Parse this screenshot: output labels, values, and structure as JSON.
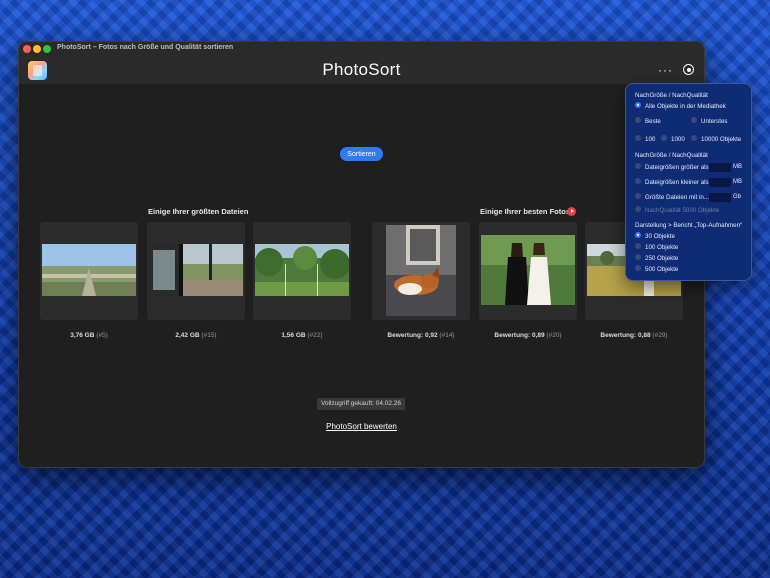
{
  "window": {
    "title": "PhotoSort – Fotos nach Größe und Qualität sortieren",
    "app_name": "PhotoSort"
  },
  "toolbar": {
    "more_icon": "more-icon",
    "settings_icon": "settings-icon",
    "more_glyph": "···"
  },
  "main": {
    "sort_button": "Sortieren",
    "largest_title": "Einige Ihrer größten Dateien",
    "best_title": "Einige Ihrer besten Fotos",
    "largest": [
      {
        "size": "3,76 GB",
        "rank": "(#5)"
      },
      {
        "size": "2,42 GB",
        "rank": "(#15)"
      },
      {
        "size": "1,56 GB",
        "rank": "(#22)"
      }
    ],
    "best": [
      {
        "score": "Bewertung: 0,92",
        "rank": "(#14)"
      },
      {
        "score": "Bewertung: 0,89",
        "rank": "(#20)"
      },
      {
        "score": "Bewertung: 0,88",
        "rank": "(#29)"
      }
    ],
    "purchase_text": "Vollzugriff gekauft: 04.02.26",
    "rate_link": "PhotoSort bewerten"
  },
  "panel": {
    "heading1": "NachGröße / NachQualität",
    "all_objects": "Alle Objekte in der Mediathek",
    "best": "Beste",
    "lowest": "Unterstes",
    "n100": "100",
    "n1000": "1000",
    "n10000": "10000 Objekte",
    "heading2": "NachGröße / NachQualität",
    "size_larger": "Dateigrößen größer als",
    "size_smaller": "Dateigrößen kleiner als",
    "largest_with": "Größte Dateien mit in...",
    "unit_mb": "MB",
    "unit_gb": "Gb",
    "quality_dim": "NachQualität 5000 Objekte",
    "heading3": "Darstellung > Bericht „Top-Aufnahmen“",
    "r30": "30 Objekte",
    "r100": "100 Objekte",
    "r250": "250 Objekte",
    "r500": "500 Objekte"
  },
  "colors": {
    "accent": "#2f7bf6",
    "window_bg": "#1f1f1f",
    "panel_bg": "#0e2b74",
    "play_red": "#e04040"
  }
}
